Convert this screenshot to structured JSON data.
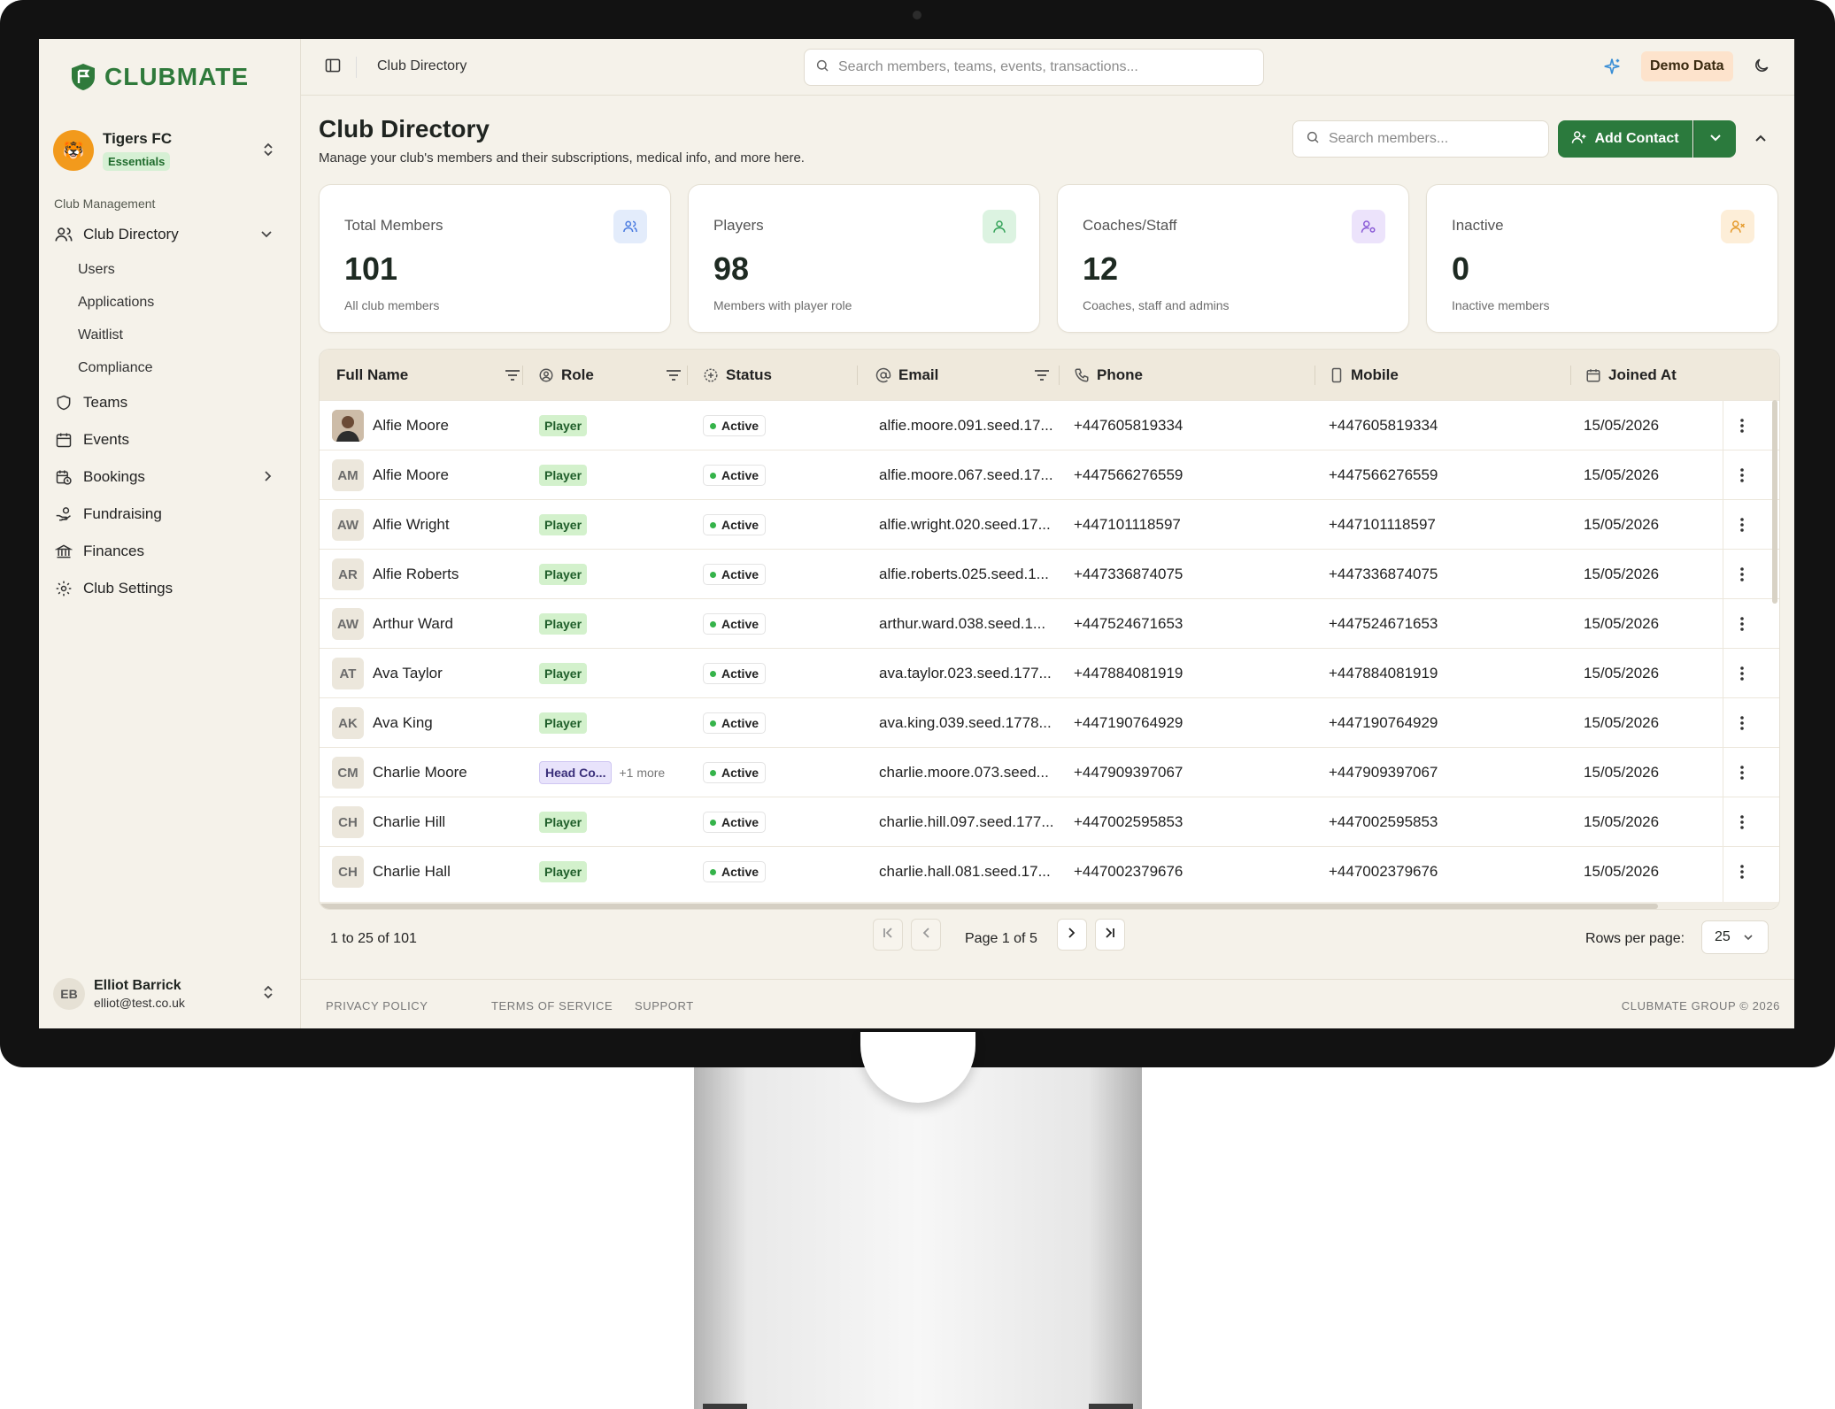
{
  "app": {
    "name": "CLUBMATE"
  },
  "club": {
    "name": "Tigers FC",
    "plan": "Essentials"
  },
  "sidebar": {
    "section_label": "Club Management",
    "items": [
      {
        "label": "Club Directory",
        "icon": "users-icon",
        "expanded": true
      },
      {
        "label": "Teams",
        "icon": "shield-icon"
      },
      {
        "label": "Events",
        "icon": "calendar-icon"
      },
      {
        "label": "Bookings",
        "icon": "calendar-clock-icon",
        "has_children": true
      },
      {
        "label": "Fundraising",
        "icon": "hand-coins-icon"
      },
      {
        "label": "Finances",
        "icon": "bank-icon"
      },
      {
        "label": "Club Settings",
        "icon": "gear-icon"
      }
    ],
    "subitems": [
      "Users",
      "Applications",
      "Waitlist",
      "Compliance"
    ]
  },
  "user": {
    "initials": "EB",
    "name": "Elliot Barrick",
    "email": "elliot@test.co.uk"
  },
  "topbar": {
    "breadcrumb": "Club Directory",
    "search_placeholder": "Search members, teams, events, transactions...",
    "demo_label": "Demo Data"
  },
  "page": {
    "title": "Club Directory",
    "subtitle": "Manage your club's members and their subscriptions, medical info, and more here.",
    "search_placeholder": "Search members...",
    "add_label": "Add Contact"
  },
  "stats": [
    {
      "label": "Total Members",
      "value": "101",
      "desc": "All club members",
      "color": "#4a7be0",
      "bg": "#e3ecfb"
    },
    {
      "label": "Players",
      "value": "98",
      "desc": "Members with player role",
      "color": "#35a35a",
      "bg": "#dcf3e1"
    },
    {
      "label": "Coaches/Staff",
      "value": "12",
      "desc": "Coaches, staff and admins",
      "color": "#8a5bd6",
      "bg": "#ece3fb"
    },
    {
      "label": "Inactive",
      "value": "0",
      "desc": "Inactive members",
      "color": "#e59a2b",
      "bg": "#fdeed8"
    }
  ],
  "table": {
    "columns": [
      "Full Name",
      "Role",
      "Status",
      "Email",
      "Phone",
      "Mobile",
      "Joined At"
    ],
    "rows": [
      {
        "initials": "",
        "name": "Alfie Moore",
        "role": "Player",
        "more": "",
        "status": "Active",
        "email": "alfie.moore.091.seed.17...",
        "phone": "+447605819334",
        "mobile": "+447605819334",
        "joined": "15/05/2026"
      },
      {
        "initials": "AM",
        "name": "Alfie Moore",
        "role": "Player",
        "more": "",
        "status": "Active",
        "email": "alfie.moore.067.seed.17...",
        "phone": "+447566276559",
        "mobile": "+447566276559",
        "joined": "15/05/2026"
      },
      {
        "initials": "AW",
        "name": "Alfie Wright",
        "role": "Player",
        "more": "",
        "status": "Active",
        "email": "alfie.wright.020.seed.17...",
        "phone": "+447101118597",
        "mobile": "+447101118597",
        "joined": "15/05/2026"
      },
      {
        "initials": "AR",
        "name": "Alfie Roberts",
        "role": "Player",
        "more": "",
        "status": "Active",
        "email": "alfie.roberts.025.seed.1...",
        "phone": "+447336874075",
        "mobile": "+447336874075",
        "joined": "15/05/2026"
      },
      {
        "initials": "AW",
        "name": "Arthur Ward",
        "role": "Player",
        "more": "",
        "status": "Active",
        "email": "arthur.ward.038.seed.1...",
        "phone": "+447524671653",
        "mobile": "+447524671653",
        "joined": "15/05/2026"
      },
      {
        "initials": "AT",
        "name": "Ava Taylor",
        "role": "Player",
        "more": "",
        "status": "Active",
        "email": "ava.taylor.023.seed.177...",
        "phone": "+447884081919",
        "mobile": "+447884081919",
        "joined": "15/05/2026"
      },
      {
        "initials": "AK",
        "name": "Ava King",
        "role": "Player",
        "more": "",
        "status": "Active",
        "email": "ava.king.039.seed.1778...",
        "phone": "+447190764929",
        "mobile": "+447190764929",
        "joined": "15/05/2026"
      },
      {
        "initials": "CM",
        "name": "Charlie Moore",
        "role": "Head Co...",
        "more": "+1 more",
        "status": "Active",
        "email": "charlie.moore.073.seed...",
        "phone": "+447909397067",
        "mobile": "+447909397067",
        "joined": "15/05/2026"
      },
      {
        "initials": "CH",
        "name": "Charlie Hill",
        "role": "Player",
        "more": "",
        "status": "Active",
        "email": "charlie.hill.097.seed.177...",
        "phone": "+447002595853",
        "mobile": "+447002595853",
        "joined": "15/05/2026"
      },
      {
        "initials": "CH",
        "name": "Charlie Hall",
        "role": "Player",
        "more": "",
        "status": "Active",
        "email": "charlie.hall.081.seed.17...",
        "phone": "+447002379676",
        "mobile": "+447002379676",
        "joined": "15/05/2026"
      }
    ]
  },
  "pagination": {
    "count_text": "1 to 25 of 101",
    "page_text": "Page 1 of 5",
    "rows_label": "Rows per page:",
    "rows_value": "25"
  },
  "footer": {
    "privacy": "PRIVACY POLICY",
    "terms": "TERMS OF SERVICE",
    "support": "SUPPORT",
    "copyright": "CLUBMATE GROUP © 2026"
  }
}
